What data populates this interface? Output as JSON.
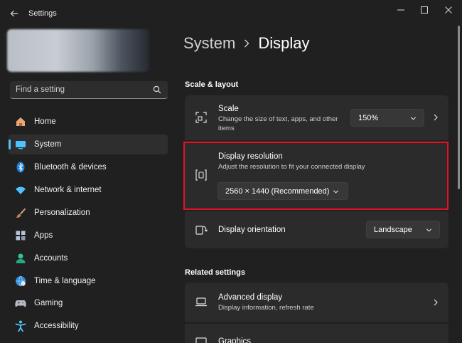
{
  "app": {
    "title": "Settings"
  },
  "search": {
    "placeholder": "Find a setting"
  },
  "nav": {
    "items": [
      {
        "label": "Home"
      },
      {
        "label": "System"
      },
      {
        "label": "Bluetooth & devices"
      },
      {
        "label": "Network & internet"
      },
      {
        "label": "Personalization"
      },
      {
        "label": "Apps"
      },
      {
        "label": "Accounts"
      },
      {
        "label": "Time & language"
      },
      {
        "label": "Gaming"
      },
      {
        "label": "Accessibility"
      }
    ],
    "active_index": 1
  },
  "breadcrumb": {
    "parent": "System",
    "current": "Display"
  },
  "scale_layout": {
    "heading": "Scale & layout",
    "scale": {
      "title": "Scale",
      "subtitle": "Change the size of text, apps, and other items",
      "value": "150%"
    },
    "resolution": {
      "title": "Display resolution",
      "subtitle": "Adjust the resolution to fit your connected display",
      "value": "2560 × 1440 (Recommended)"
    },
    "orientation": {
      "title": "Display orientation",
      "value": "Landscape"
    }
  },
  "related": {
    "heading": "Related settings",
    "advanced": {
      "title": "Advanced display",
      "subtitle": "Display information, refresh rate"
    },
    "graphics": {
      "title": "Graphics"
    }
  },
  "colors": {
    "accent": "#4cc2ff",
    "highlight_border": "#e81123",
    "background": "#202020",
    "card": "#2b2b2b"
  }
}
